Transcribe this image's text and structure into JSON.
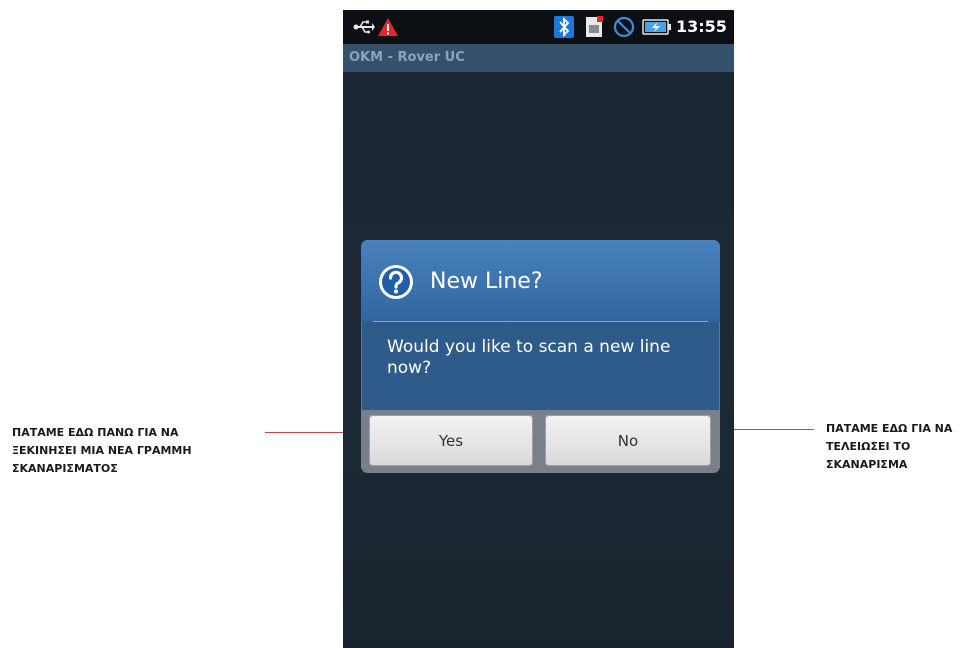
{
  "annotations": {
    "left_lines": [
      "ΠΑΤΑΜΕ ΕΔΩ ΠΑΝΩ ΓΙΑ ΝΑ",
      "ΞΕΚΙΝΗΣΕΙ ΜΙΑ ΝΕΑ ΓΡΑΜΜΗ",
      "ΣΚΑΝΑΡΙΣΜΑΤΟΣ"
    ],
    "right_lines": [
      "ΠΑΤΑΜΕ ΕΔΩ ΓΙΑ ΝΑ",
      "ΤΕΛΕΙΩΣΕΙ ΤΟ",
      "ΣΚΑΝΑΡΙΣΜΑ"
    ],
    "pointer_color": "#d94040"
  },
  "status_bar": {
    "icons": [
      "usb-icon",
      "warning-icon",
      "bluetooth-icon",
      "sim-card-icon",
      "no-entry-icon",
      "battery-icon"
    ],
    "time": "13:55"
  },
  "app": {
    "title": "OKM - Rover UC"
  },
  "dialog": {
    "icon": "question-icon",
    "title": "New Line?",
    "message": "Would you like to scan a new line now?",
    "yes_label": "Yes",
    "no_label": "No",
    "accent_color": "#2f66a1"
  }
}
